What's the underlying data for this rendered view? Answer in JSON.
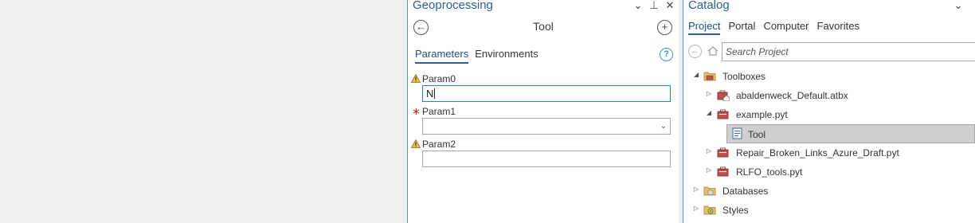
{
  "geoprocessing": {
    "title": "Geoprocessing",
    "tool_title": "Tool",
    "tabs": [
      {
        "label": "Parameters",
        "active": true
      },
      {
        "label": "Environments",
        "active": false
      }
    ],
    "params": [
      {
        "label": "Param0",
        "value": "N",
        "status": "warning"
      },
      {
        "label": "Param1",
        "value": "",
        "status": "required"
      },
      {
        "label": "Param2",
        "value": "",
        "status": "warning"
      }
    ],
    "back_icon": "back-arrow-icon",
    "add_icon": "plus-icon",
    "help_icon": "question-icon"
  },
  "catalog": {
    "title": "Catalog",
    "tabs": [
      {
        "label": "Project",
        "active": true
      },
      {
        "label": "Portal",
        "active": false
      },
      {
        "label": "Computer",
        "active": false
      },
      {
        "label": "Favorites",
        "active": false
      }
    ],
    "search_placeholder": "Search Project",
    "tree": {
      "toolboxes": "Toolboxes",
      "default_atbx": "abaldenweck_Default.atbx",
      "example_pyt": "example.pyt",
      "tool": "Tool",
      "repair_pyt": "Repair_Broken_Links_Azure_Draft.pyt",
      "rlfo_pyt": "RLFO_tools.pyt",
      "databases": "Databases",
      "styles": "Styles"
    }
  },
  "colors": {
    "accent": "#2b5f91",
    "focus": "#2b7bc9",
    "warning": "#d89a2b",
    "required": "#c0392b",
    "toolbox": "#c0504d",
    "folder": "#e6c36a"
  }
}
